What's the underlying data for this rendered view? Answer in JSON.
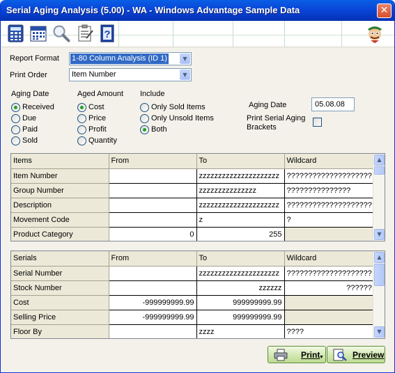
{
  "window": {
    "title": "Serial Aging Analysis (5.00) - WA - Windows Advantage Sample Data",
    "close_glyph": "✕"
  },
  "toolbar": {
    "icons": [
      "calculator-icon",
      "calendar-icon",
      "magnifier-icon",
      "checklist-icon",
      "help-book-icon"
    ],
    "help_glyph": "?"
  },
  "report_format": {
    "label": "Report Format",
    "value": "1-80 Column Analysis (ID 1)"
  },
  "print_order": {
    "label": "Print Order",
    "value": "Item Number"
  },
  "aging_date_group": {
    "label": "Aging Date",
    "options": [
      "Received",
      "Due",
      "Paid",
      "Sold"
    ],
    "selected": 0
  },
  "aged_amount_group": {
    "label": "Aged Amount",
    "options": [
      "Cost",
      "Price",
      "Profit",
      "Quantity"
    ],
    "selected": 0
  },
  "include_group": {
    "label": "Include",
    "options": [
      "Only Sold Items",
      "Only Unsold Items",
      "Both"
    ],
    "selected": 2
  },
  "aging_date_field": {
    "label": "Aging Date",
    "value": "05.08.08"
  },
  "print_brackets": {
    "label_line1": "Print Serial Aging",
    "label_line2": "Brackets",
    "checked": false
  },
  "items_grid": {
    "headers": [
      "Items",
      "From",
      "To",
      "Wildcard"
    ],
    "rows": [
      {
        "label": "Item Number",
        "from": "",
        "to": "zzzzzzzzzzzzzzzzzzzzz",
        "wildcard": "????????????????????"
      },
      {
        "label": "Group Number",
        "from": "",
        "to": "zzzzzzzzzzzzzzz",
        "wildcard": "???????????????"
      },
      {
        "label": "Description",
        "from": "",
        "to": "zzzzzzzzzzzzzzzzzzzzz",
        "wildcard": "????????????????????"
      },
      {
        "label": "Movement Code",
        "from": "",
        "to": "z",
        "wildcard": "?"
      },
      {
        "label": "Product Category",
        "from": "0",
        "to": "255",
        "wildcard": ""
      }
    ]
  },
  "serials_grid": {
    "headers": [
      "Serials",
      "From",
      "To",
      "Wildcard"
    ],
    "rows": [
      {
        "label": "Serial Number",
        "from": "",
        "to": "zzzzzzzzzzzzzzzzzzzzz",
        "wildcard": "????????????????????"
      },
      {
        "label": "Stock Number",
        "from": "",
        "to": "zzzzzz",
        "wildcard": "??????"
      },
      {
        "label": "Cost",
        "from": "-999999999.99",
        "to": "999999999.99",
        "wildcard": ""
      },
      {
        "label": "Selling Price",
        "from": "-999999999.99",
        "to": "999999999.99",
        "wildcard": ""
      },
      {
        "label": "Floor By",
        "from": "",
        "to": "zzzz",
        "wildcard": "????"
      }
    ]
  },
  "buttons": {
    "print": "Print",
    "preview": "Preview"
  },
  "scroll_glyphs": {
    "up": "▲",
    "down": "▼"
  },
  "dropdown_glyph": "▼",
  "colors": {
    "title_bar": "#0a46d8",
    "selection": "#316ac5",
    "radio_dot": "#21a121",
    "button_green": "#d1e8b1"
  }
}
